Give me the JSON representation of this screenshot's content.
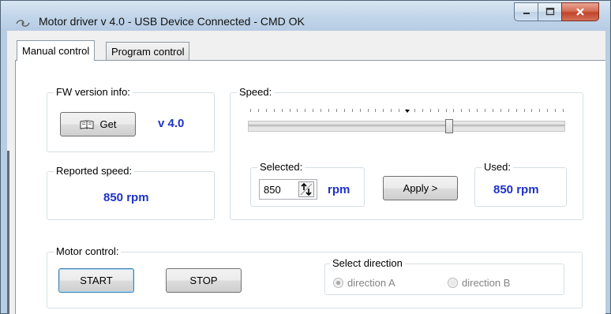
{
  "window": {
    "title": "Motor driver v 4.0 - USB Device Connected - CMD OK"
  },
  "tabs": [
    {
      "label": "Manual control",
      "active": true
    },
    {
      "label": "Program control",
      "active": false
    }
  ],
  "fw_version": {
    "legend": "FW version info:",
    "get_button": "Get",
    "value": "v 4.0"
  },
  "reported_speed": {
    "legend": "Reported speed:",
    "value": "850 rpm"
  },
  "speed": {
    "legend": "Speed:",
    "slider_fraction": 0.635
  },
  "selected": {
    "legend": "Selected:",
    "value": "850",
    "unit": "rpm"
  },
  "apply_button": "Apply >",
  "used": {
    "legend": "Used:",
    "value": "850 rpm"
  },
  "motor_control": {
    "legend": "Motor control:",
    "start_button": "START",
    "stop_button": "STOP"
  },
  "direction": {
    "legend": "Select direction",
    "option_a": "direction A",
    "option_b": "direction B",
    "selected": "direction A",
    "enabled": false
  },
  "colors": {
    "value_blue": "#1f33c8",
    "close_button": "#c2442a"
  }
}
